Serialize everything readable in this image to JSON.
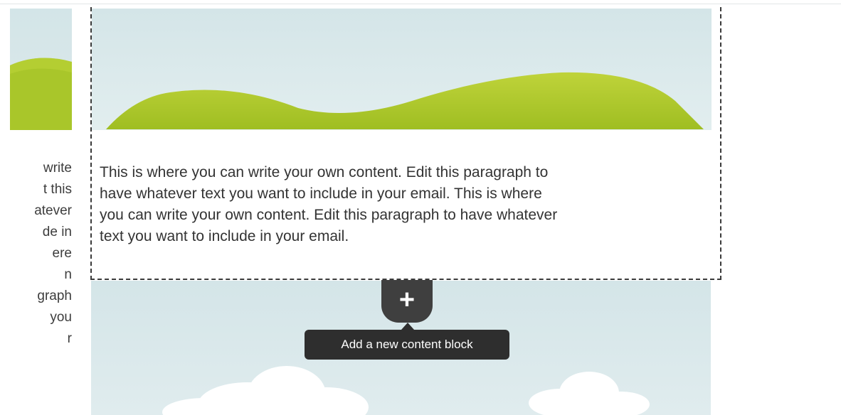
{
  "editor": {
    "left_column": {
      "text_fragments": [
        "write",
        "t this",
        "atever",
        "de in",
        "ere",
        "n",
        "graph",
        "you",
        "r"
      ]
    },
    "selected_block": {
      "paragraph_lines": [
        "This is where you can write your own content. Edit this paragraph to",
        "have whatever text you want to include in your email. This is where",
        "you can write your own content. Edit this paragraph to have whatever",
        "text you want to include in your email."
      ]
    },
    "add_block": {
      "button_symbol": "+",
      "tooltip": "Add a new content block"
    }
  },
  "colors": {
    "sky": "#d4e5e8",
    "hill": "#a9c62a",
    "cloud": "#ffffff",
    "button": "#3f3f3f",
    "tooltip_bg": "#2e2e2e",
    "dashed_border": "#3a3a3a"
  }
}
